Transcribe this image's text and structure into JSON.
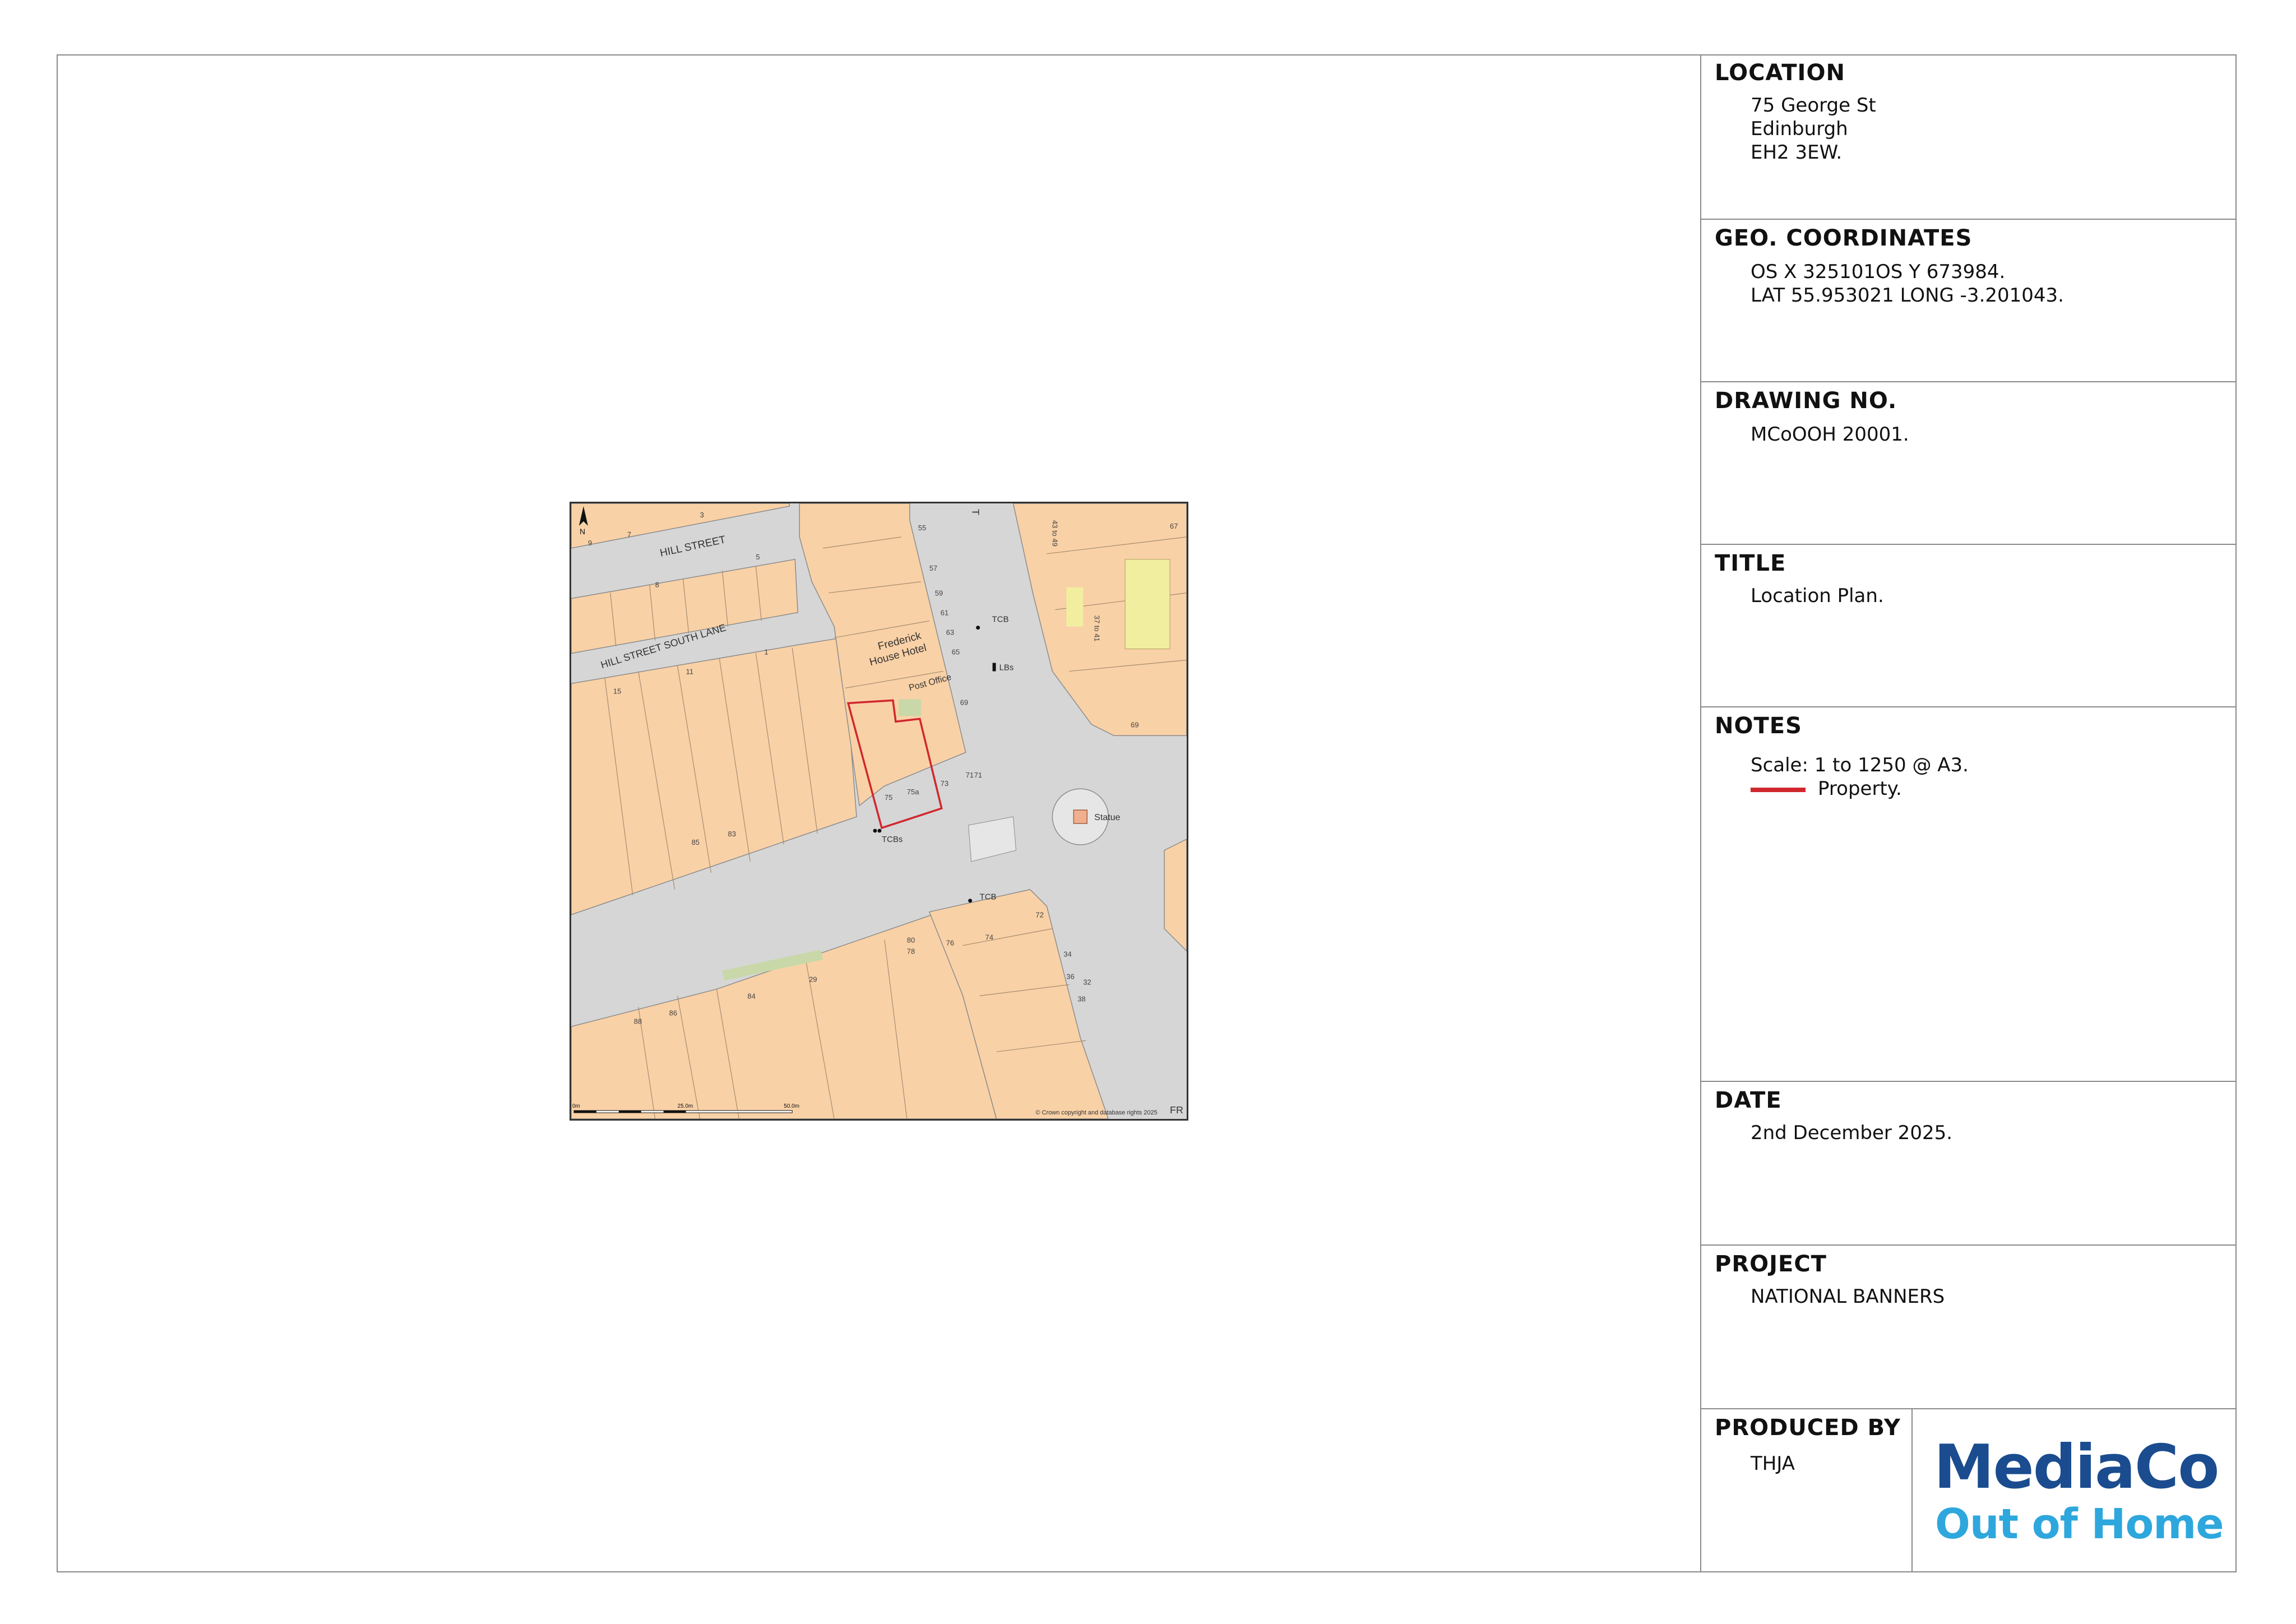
{
  "location": {
    "heading": "LOCATION",
    "line1": "75 George St",
    "line2": "Edinburgh",
    "line3": "EH2 3EW."
  },
  "geo": {
    "heading": "GEO. COORDINATES",
    "line1": "OS X 325101OS Y 673984.",
    "line2": "LAT 55.953021 LONG -3.201043."
  },
  "drawing": {
    "heading": "DRAWING NO.",
    "value": "MCoOOH 20001."
  },
  "title_block": {
    "heading": "TITLE",
    "value": "Location Plan."
  },
  "notes": {
    "heading": "NOTES",
    "scale": "Scale: 1 to 1250 @ A3.",
    "legend_label": "Property.",
    "legend_color": "#d0272e"
  },
  "date": {
    "heading": "DATE",
    "value": "2nd December 2025."
  },
  "project": {
    "heading": "PROJECT",
    "value": "NATIONAL BANNERS"
  },
  "produced": {
    "heading": "PRODUCED BY",
    "value": "THJA"
  },
  "logo": {
    "line1": "MediaCo",
    "line2": "Out of Home",
    "color1": "#1a4c8f",
    "color2": "#2ea7dd"
  },
  "map": {
    "north": "N",
    "streets": {
      "hill_street": "HILL STREET",
      "hill_street_south_lane": "HILL STREET SOUTH LANE"
    },
    "labels": {
      "hotel1": "Frederick",
      "hotel2": "House Hotel",
      "post_office": "Post Office",
      "statue": "Statue",
      "tcb1": "TCB",
      "tcb2": "TCB",
      "tcbs": "TCBs",
      "lbs": "LBs",
      "n75": "75",
      "n75a": "75a",
      "n73": "73",
      "n71": "71",
      "n71b": "71",
      "n85": "85",
      "n83": "83",
      "n3": "3",
      "n7": "7",
      "n9": "9",
      "n5": "5",
      "n8": "8",
      "n11": "11",
      "n15": "15",
      "n1": "1",
      "n69": "69",
      "n88": "88",
      "n86": "86",
      "n84": "84",
      "n29": "29",
      "n74": "74",
      "n72": "72",
      "n76": "76",
      "n78": "78",
      "n80": "80",
      "r43_49": "43 to 49",
      "r37_41": "37 to 41",
      "n65": "65",
      "n55": "55",
      "n63": "63",
      "n61": "61",
      "n57": "57",
      "n59": "59",
      "n67": "67",
      "n69b": "69",
      "n34": "34",
      "n36": "36",
      "n38": "38",
      "n32": "32"
    },
    "scalebar": {
      "zero": "0m",
      "mid": "25.0m",
      "end": "50.0m"
    },
    "copyright": "© Crown copyright and database rights 2025",
    "edge_fr": "FR",
    "edge_t": "T"
  }
}
